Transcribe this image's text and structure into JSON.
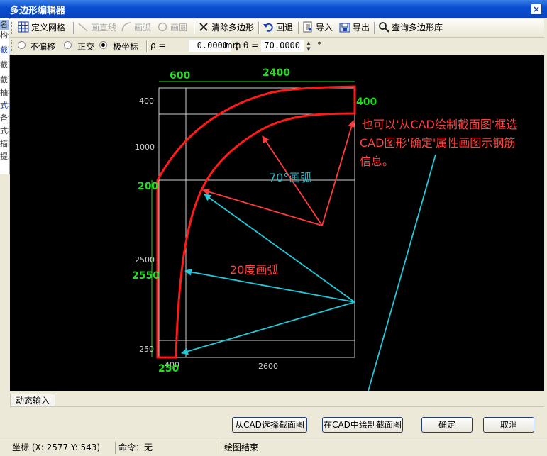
{
  "window": {
    "title": "多边形编辑器",
    "close": "×"
  },
  "left_strip": [
    "名称",
    "构件",
    "截面",
    "截面",
    "截面",
    "抽样",
    "式样",
    "备注",
    "式样",
    "描图",
    "提示"
  ],
  "toolbar": {
    "define_grid": "定义网格",
    "draw_line": "画直线",
    "draw_arc": "画弧",
    "draw_circle": "画圆",
    "clear_polygon": "清除多边形",
    "undo": "回退",
    "import": "导入",
    "export": "导出",
    "query_library": "查询多边形库"
  },
  "options": {
    "no_offset": "不偏移",
    "orthogonal": "正交",
    "polar": "极坐标",
    "selected_mode": "极坐标",
    "rho_label": "ρ =",
    "rho_value": "0.0000",
    "rho_unit": "mm",
    "theta_label": "θ =",
    "theta_value": "70.0000",
    "theta_unit": "°"
  },
  "drawing": {
    "dims_top": [
      "600",
      "2400"
    ],
    "dim_right": "400",
    "left_labels_white": [
      "400",
      "1000",
      "2500",
      "250"
    ],
    "left_labels_green": [
      "200",
      "2550"
    ],
    "bottom_labels_white": [
      "400",
      "2600"
    ],
    "bottom_label_green": "250",
    "annotation_arc70": "70°画弧",
    "annotation_arc20": "20度画弧",
    "annotation_cad": [
      "也可以'从CAD绘制截面图'框选",
      "CAD图形'确定'属性画图示钢筋",
      "信息。"
    ]
  },
  "colors": {
    "grid": "#d0d0d0",
    "shape": "#ff1a1a",
    "arrow_red": "#ff3b3b",
    "arrow_cyan": "#22c8d8",
    "green": "#22dd22",
    "text_red": "#ff4040",
    "text_cyan": "#22b8c8"
  },
  "dynamic_input_tab": "动态输入",
  "buttons": {
    "select_from_cad": "从CAD选择截面图",
    "draw_in_cad": "在CAD中绘制截面图",
    "ok": "确定",
    "cancel": "取消"
  },
  "status": {
    "coords": "坐标 (X: 2577 Y: 543)",
    "command": "命令：无",
    "message": "绘图结束"
  }
}
